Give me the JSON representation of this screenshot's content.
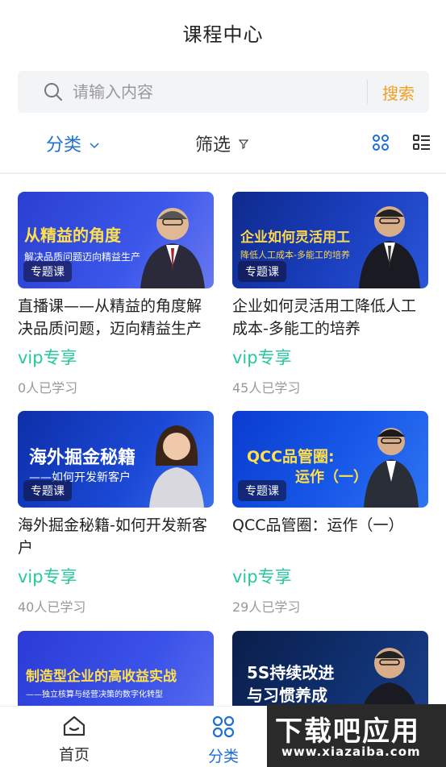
{
  "header": {
    "title": "课程中心"
  },
  "search": {
    "placeholder": "请输入内容",
    "button": "搜索"
  },
  "filters": {
    "category": "分类",
    "screen": "筛选"
  },
  "courses": [
    {
      "thumb_title": "从精益的角度",
      "thumb_sub": "解决品质问题迈向精益生产",
      "tag": "专题课",
      "title": "直播课——从精益的角度解决品质问题，迈向精益生产",
      "vip": "vip专享",
      "learners": "0人已学习"
    },
    {
      "thumb_title": "企业如何灵活用工",
      "thumb_sub": "降低人工成本-多能工的培养",
      "tag": "专题课",
      "title": "企业如何灵活用工降低人工成本-多能工的培养",
      "vip": "vip专享",
      "learners": "45人已学习"
    },
    {
      "thumb_title": "海外掘金秘籍",
      "thumb_sub": "——如何开发新客户",
      "tag": "专题课",
      "title": "海外掘金秘籍-如何开发新客户",
      "vip": "vip专享",
      "learners": "40人已学习"
    },
    {
      "thumb_title": "QCC品管圈:",
      "thumb_sub": "运作（一）",
      "tag": "专题课",
      "title": "QCC品管圈：运作（一）",
      "vip": "vip专享",
      "learners": "29人已学习"
    },
    {
      "thumb_title": "制造型企业的高收益实战",
      "thumb_sub": "——独立核算与经营决策的数字化转型"
    },
    {
      "thumb_title": "5S持续改进",
      "thumb_sub": "与习惯养成"
    }
  ],
  "nav": {
    "home": "首页",
    "category": "分类"
  },
  "watermark": {
    "big": "下载吧应用",
    "small": "www.xiazaiba.com"
  },
  "colors": {
    "accent": "#1d6fd6",
    "search_button": "#f0a020",
    "vip": "#27c79e"
  }
}
